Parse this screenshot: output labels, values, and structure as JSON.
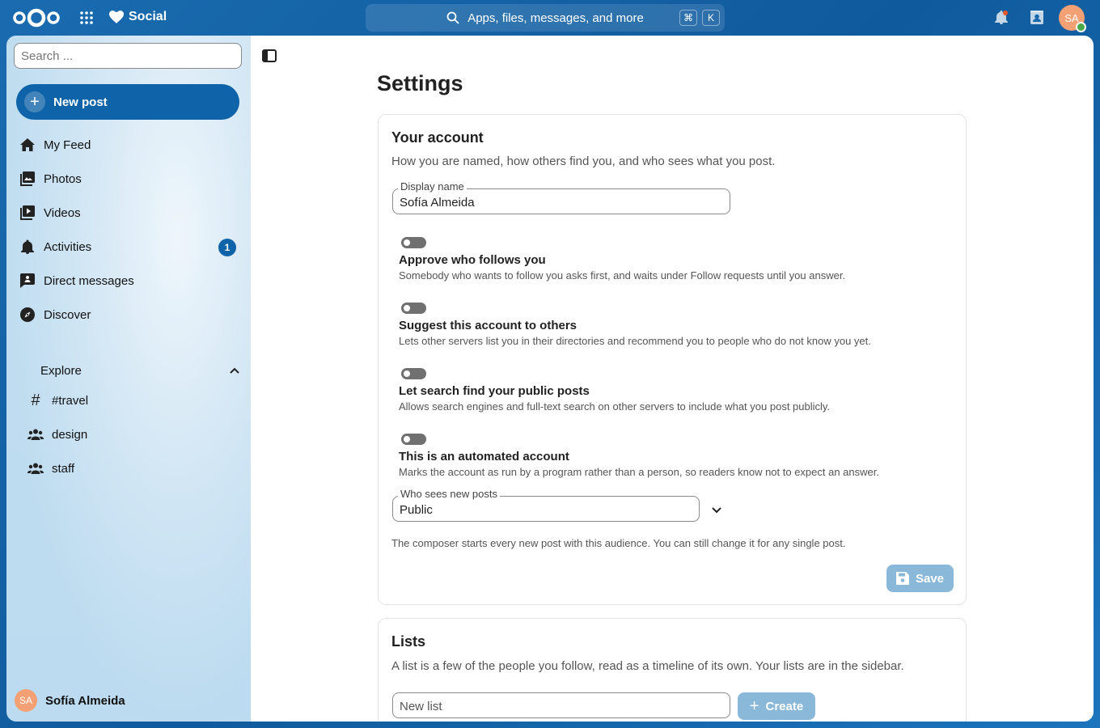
{
  "header": {
    "app_name": "Social",
    "search_placeholder": "Apps, files, messages, and more",
    "kbd_cmd": "⌘",
    "kbd_k": "K",
    "avatar_initials": "SA"
  },
  "sidebar": {
    "search_placeholder": "Search ...",
    "new_post_label": "New post",
    "items": [
      {
        "label": "My Feed",
        "icon": "home-icon"
      },
      {
        "label": "Photos",
        "icon": "image-icon"
      },
      {
        "label": "Videos",
        "icon": "video-icon"
      },
      {
        "label": "Activities",
        "icon": "bell-icon",
        "badge": "1"
      },
      {
        "label": "Direct messages",
        "icon": "message-icon"
      },
      {
        "label": "Discover",
        "icon": "compass-icon"
      }
    ],
    "explore_label": "Explore",
    "explore_items": [
      {
        "label": "#travel",
        "icon": "hash-icon"
      },
      {
        "label": "design",
        "icon": "group-icon"
      },
      {
        "label": "staff",
        "icon": "group-icon"
      }
    ],
    "user_name": "Sofía Almeida",
    "user_initials": "SA"
  },
  "main": {
    "title": "Settings",
    "account": {
      "title": "Your account",
      "description": "How you are named, how others find you, and who sees what you post.",
      "display_name_label": "Display name",
      "display_name_value": "Sofía Almeida",
      "options": [
        {
          "title": "Approve who follows you",
          "description": "Somebody who wants to follow you asks first, and waits under Follow requests until you answer.",
          "enabled": false
        },
        {
          "title": "Suggest this account to others",
          "description": "Lets other servers list you in their directories and recommend you to people who do not know you yet.",
          "enabled": false
        },
        {
          "title": "Let search find your public posts",
          "description": "Allows search engines and full-text search on other servers to include what you post publicly.",
          "enabled": false
        },
        {
          "title": "This is an automated account",
          "description": "Marks the account as run by a program rather than a person, so readers know not to expect an answer.",
          "enabled": false
        }
      ],
      "audience_label": "Who sees new posts",
      "audience_value": "Public",
      "audience_help": "The composer starts every new post with this audience. You can still change it for any single post.",
      "save_label": "Save"
    },
    "lists": {
      "title": "Lists",
      "description": "A list is a few of the people you follow, read as a timeline of its own. Your lists are in the sidebar.",
      "new_list_placeholder": "New list",
      "create_label": "Create"
    }
  }
}
